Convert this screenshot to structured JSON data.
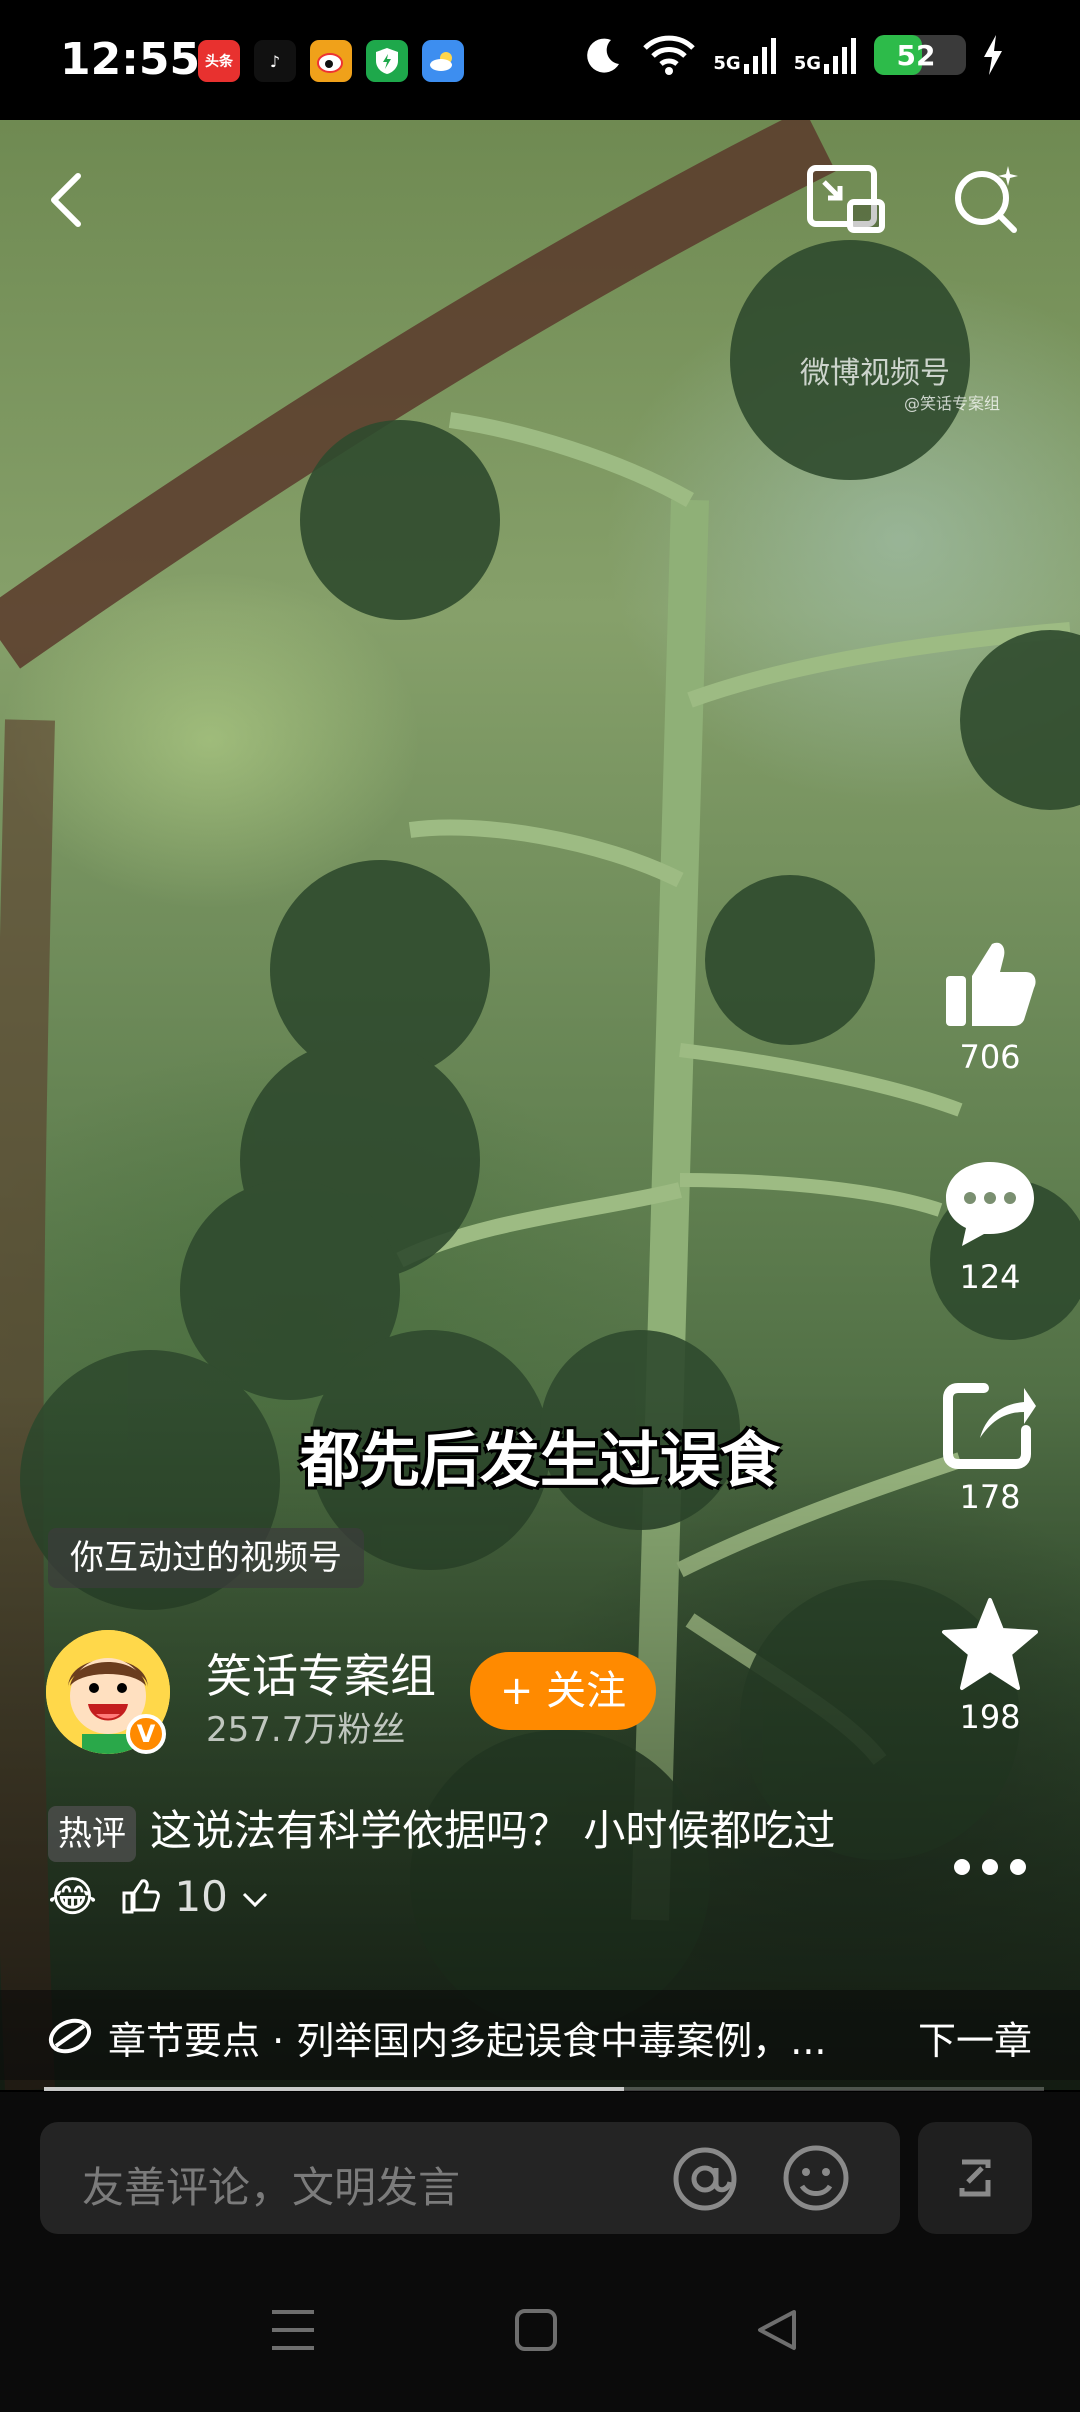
{
  "status_bar": {
    "time": "12:55",
    "apps": [
      {
        "name": "toutiao-icon",
        "label": "头条",
        "color": "#e8312f"
      },
      {
        "name": "douyin-icon",
        "label": "♪",
        "color": "#111111"
      },
      {
        "name": "weibo-icon",
        "label": "",
        "color": "#f0a11a"
      },
      {
        "name": "shield-app-icon",
        "label": "",
        "color": "#1ea84b"
      },
      {
        "name": "weather-icon",
        "label": "",
        "color": "#3d8ef0"
      }
    ],
    "sig1": "5G",
    "sig2": "5G",
    "battery": "52",
    "battery_level": 0.52
  },
  "video": {
    "watermark": "微博视频号",
    "watermark_sub": "@笑话专案组",
    "subtitle": "都先后发生过误食",
    "progress": 0.58
  },
  "actions": {
    "like_count": "706",
    "comment_count": "124",
    "share_count": "178",
    "favorite_count": "198"
  },
  "interacted_tag": "你互动过的视频号",
  "author": {
    "name": "笑话专案组",
    "fans": "257.7万粉丝",
    "follow_label": "+ 关注"
  },
  "hot_comment": {
    "badge": "热评",
    "text": "这说法有科学依据吗？ 小时候都吃过😂",
    "likes": "10"
  },
  "chapter": {
    "text": "章节要点 · 列举国内多起误食中毒案例，...",
    "next_label": "下一章"
  },
  "comment_input": {
    "placeholder": "友善评论，文明发言"
  }
}
